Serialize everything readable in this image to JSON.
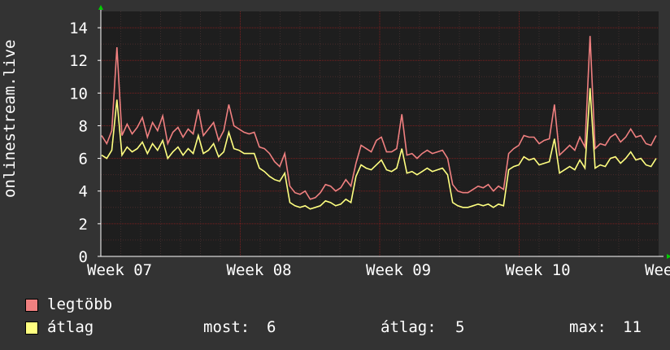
{
  "chart_data": {
    "type": "line",
    "ylabel": "onlinestream.live",
    "xlabel": "",
    "x_ticks": [
      "Week 07",
      "Week 08",
      "Week 09",
      "Week 10",
      "Week 11"
    ],
    "y_ticks": [
      0,
      2,
      4,
      6,
      8,
      10,
      12,
      14
    ],
    "ylim": [
      0,
      15
    ],
    "grid": true,
    "colors": {
      "background": "#333333",
      "plot_bg": "#1e1e1e",
      "grid": "#8b1e1e",
      "axis": "#ffffff",
      "max_series": "#f08080",
      "avg_series": "#ffff80"
    },
    "series": [
      {
        "name": "legtöbb",
        "values": [
          7.4,
          6.9,
          7.7,
          12.8,
          7.4,
          8.1,
          7.5,
          7.9,
          8.5,
          7.3,
          8.2,
          7.7,
          8.6,
          6.9,
          7.6,
          7.9,
          7.3,
          7.8,
          7.5,
          9.0,
          7.4,
          7.8,
          8.2,
          7.1,
          7.7,
          9.3,
          8.0,
          7.8,
          7.6,
          7.5,
          7.6,
          6.7,
          6.6,
          6.3,
          5.8,
          5.5,
          6.3,
          4.3,
          3.9,
          3.8,
          4.0,
          3.5,
          3.6,
          3.9,
          4.4,
          4.3,
          4.0,
          4.2,
          4.7,
          4.3,
          5.7,
          6.8,
          6.6,
          6.4,
          7.1,
          7.3,
          6.4,
          6.4,
          6.6,
          8.7,
          6.2,
          6.3,
          6.0,
          6.3,
          6.5,
          6.3,
          6.4,
          6.5,
          6.0,
          4.4,
          4.0,
          3.9,
          3.9,
          4.1,
          4.3,
          4.2,
          4.4,
          4.0,
          4.3,
          4.1,
          6.3,
          6.6,
          6.8,
          7.4,
          7.3,
          7.3,
          6.9,
          7.1,
          7.2,
          9.3,
          6.2,
          6.5,
          6.8,
          6.5,
          7.3,
          6.7,
          13.5,
          6.6,
          6.9,
          6.8,
          7.3,
          7.5,
          7.0,
          7.3,
          7.8,
          7.3,
          7.4,
          6.9,
          6.8,
          7.4
        ]
      },
      {
        "name": "átlag",
        "values": [
          6.2,
          6.0,
          6.5,
          9.6,
          6.2,
          6.7,
          6.4,
          6.6,
          7.0,
          6.3,
          6.9,
          6.5,
          7.1,
          6.0,
          6.4,
          6.7,
          6.2,
          6.6,
          6.3,
          7.4,
          6.3,
          6.5,
          6.9,
          6.1,
          6.4,
          7.6,
          6.6,
          6.5,
          6.3,
          6.3,
          6.3,
          5.4,
          5.2,
          4.9,
          4.7,
          4.6,
          5.1,
          3.3,
          3.1,
          3.0,
          3.1,
          2.9,
          3.0,
          3.1,
          3.4,
          3.3,
          3.1,
          3.2,
          3.5,
          3.3,
          4.9,
          5.6,
          5.4,
          5.3,
          5.6,
          5.9,
          5.3,
          5.2,
          5.4,
          6.6,
          5.1,
          5.2,
          5.0,
          5.2,
          5.4,
          5.2,
          5.3,
          5.4,
          5.0,
          3.3,
          3.1,
          3.0,
          3.0,
          3.1,
          3.2,
          3.1,
          3.2,
          3.0,
          3.2,
          3.1,
          5.3,
          5.5,
          5.6,
          6.1,
          5.9,
          6.0,
          5.6,
          5.7,
          5.8,
          7.2,
          5.1,
          5.3,
          5.5,
          5.3,
          5.9,
          5.4,
          10.3,
          5.4,
          5.6,
          5.5,
          6.0,
          6.1,
          5.7,
          6.0,
          6.4,
          5.9,
          6.0,
          5.6,
          5.5,
          6.0
        ]
      }
    ]
  },
  "legend": [
    {
      "label": "legtöbb",
      "color": "#f08080"
    },
    {
      "label": "átlag",
      "color": "#ffff80"
    }
  ],
  "stats": {
    "now_label": "most:",
    "now_value": "6",
    "avg_label": "átlag:",
    "avg_value": "5",
    "max_label": "max:",
    "max_value": "11"
  }
}
